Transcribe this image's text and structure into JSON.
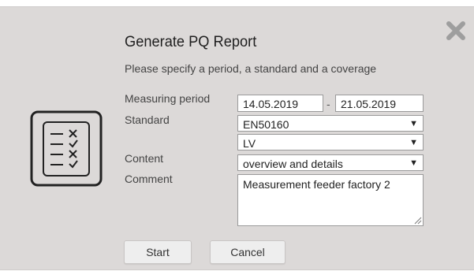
{
  "dialog": {
    "title": "Generate PQ Report",
    "subtitle": "Please specify a period, a standard and a coverage",
    "close_icon": "close-x-icon",
    "illustration_icon": "checklist-document-icon"
  },
  "form": {
    "period": {
      "label": "Measuring period",
      "from": "14.05.2019",
      "separator": "-",
      "to": "21.05.2019"
    },
    "standard": {
      "label": "Standard",
      "value": "EN50160",
      "voltage_level": "LV"
    },
    "content": {
      "label": "Content",
      "value": "overview and details"
    },
    "comment": {
      "label": "Comment",
      "value": "Measurement feeder factory 2"
    }
  },
  "buttons": {
    "start": "Start",
    "cancel": "Cancel"
  },
  "colors": {
    "dialog_bg": "#dcd9d8",
    "field_bg": "#ffffff",
    "button_bg": "#eeeeee",
    "close_icon": "#9e9e9e",
    "icon_stroke": "#222222"
  }
}
